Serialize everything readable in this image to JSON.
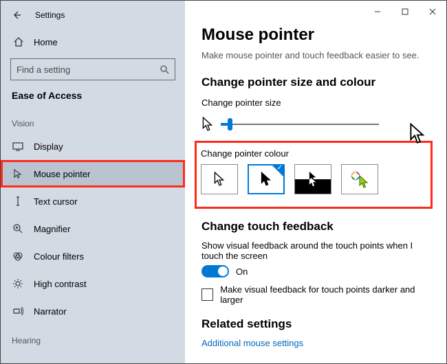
{
  "window": {
    "title": "Settings"
  },
  "sidebar": {
    "home_label": "Home",
    "search_placeholder": "Find a setting",
    "category": "Ease of Access",
    "group_vision": "Vision",
    "group_hearing": "Hearing",
    "items": [
      {
        "label": "Display"
      },
      {
        "label": "Mouse pointer"
      },
      {
        "label": "Text cursor"
      },
      {
        "label": "Magnifier"
      },
      {
        "label": "Colour filters"
      },
      {
        "label": "High contrast"
      },
      {
        "label": "Narrator"
      }
    ]
  },
  "page": {
    "title": "Mouse pointer",
    "subtitle": "Make mouse pointer and touch feedback easier to see.",
    "size_colour_heading": "Change pointer size and colour",
    "size_label": "Change pointer size",
    "colour_label": "Change pointer colour"
  },
  "touch": {
    "heading": "Change touch feedback",
    "desc": "Show visual feedback around the touch points when I touch the screen",
    "state": "On",
    "darker_label": "Make visual feedback for touch points darker and larger"
  },
  "related": {
    "heading": "Related settings",
    "link": "Additional mouse settings"
  }
}
